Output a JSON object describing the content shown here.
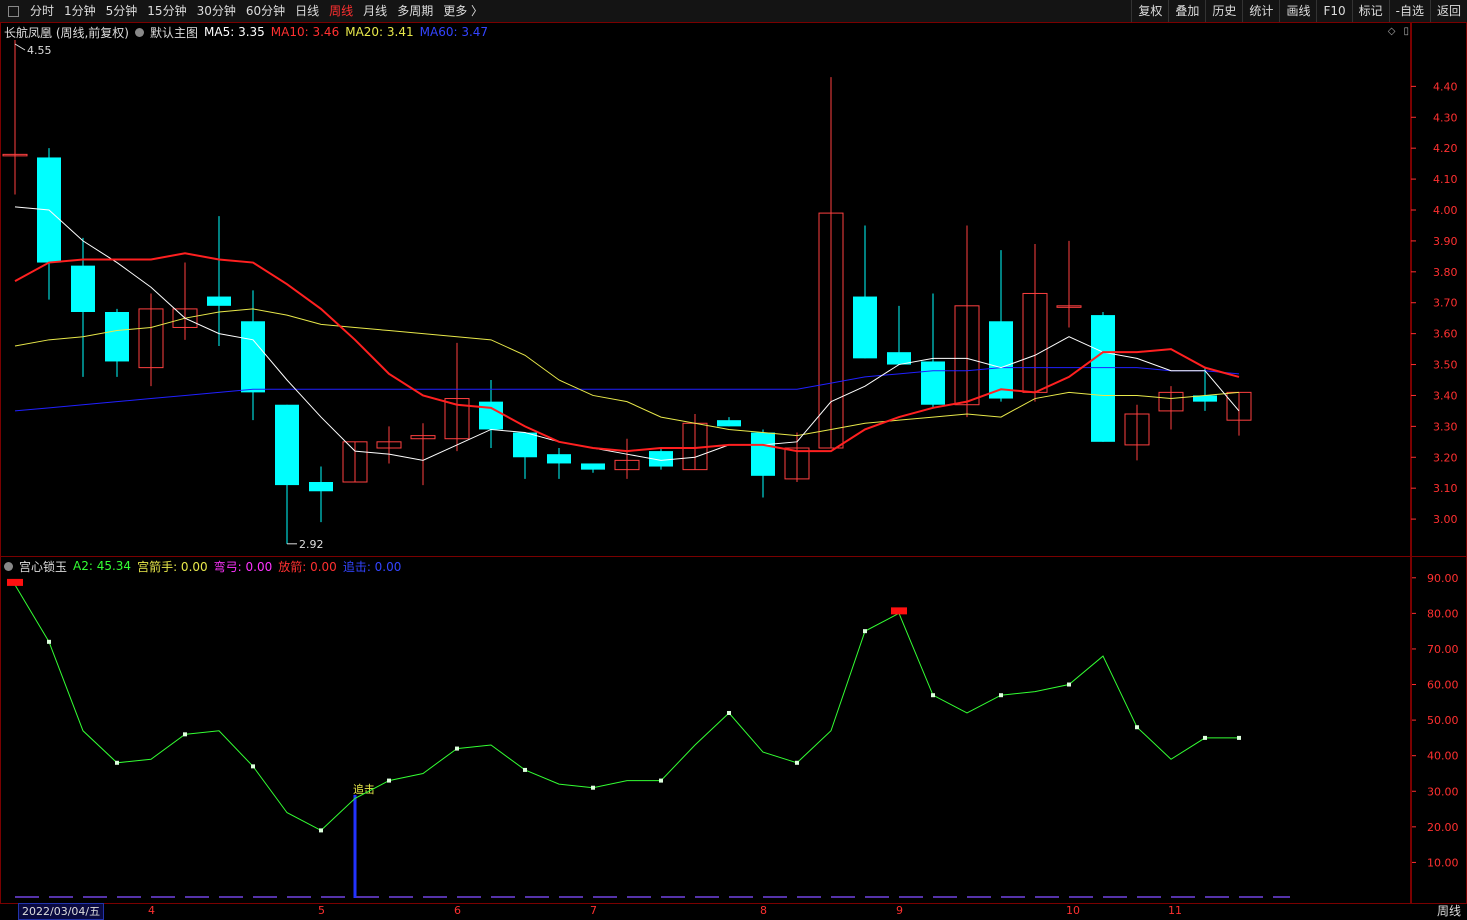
{
  "toolbar": {
    "periods": [
      "分时",
      "1分钟",
      "5分钟",
      "15分钟",
      "30分钟",
      "60分钟",
      "日线",
      "周线",
      "月线",
      "多周期",
      "更多 〉"
    ],
    "active_index": 7,
    "right_buttons": [
      "复权",
      "叠加",
      "历史",
      "统计",
      "画线",
      "F10",
      "标记",
      "-自选",
      "返回"
    ]
  },
  "main_header": {
    "stock": "长航凤凰 (周线,前复权)",
    "template": "默认主图",
    "ma5": "MA5: 3.35",
    "ma10": "MA10: 3.46",
    "ma20": "MA20: 3.41",
    "ma60": "MA60: 3.47"
  },
  "sub_header": {
    "name": "宫心锁玉",
    "a2": "A2: 45.34",
    "archer": "宫箭手: 0.00",
    "bow": "弯弓: 0.00",
    "fire": "放箭: 0.00",
    "chase": "追击: 0.00"
  },
  "colors": {
    "up": "#ff4040",
    "down": "#00ffff",
    "ma5": "#ffffff",
    "ma10": "#ff2020",
    "ma20": "#e8e84a",
    "ma60": "#2020ff",
    "a2": "#33ff33",
    "axis": "#ff3030"
  },
  "chart_data": [
    {
      "type": "candlestick",
      "y_ticks": [
        3.0,
        3.1,
        3.2,
        3.3,
        3.4,
        3.5,
        3.6,
        3.7,
        3.8,
        3.9,
        4.0,
        4.1,
        4.2,
        4.3,
        4.4
      ],
      "ylim": [
        2.9,
        4.55
      ],
      "high_label": "4.55",
      "low_label": "2.92",
      "candles": [
        {
          "o": 4.18,
          "c": 4.18,
          "h": 4.55,
          "l": 4.05
        },
        {
          "o": 4.17,
          "c": 3.83,
          "h": 4.2,
          "l": 3.71
        },
        {
          "o": 3.82,
          "c": 3.67,
          "h": 3.91,
          "l": 3.46
        },
        {
          "o": 3.67,
          "c": 3.51,
          "h": 3.68,
          "l": 3.46
        },
        {
          "o": 3.49,
          "c": 3.68,
          "h": 3.73,
          "l": 3.43
        },
        {
          "o": 3.62,
          "c": 3.68,
          "h": 3.83,
          "l": 3.58
        },
        {
          "o": 3.72,
          "c": 3.69,
          "h": 3.98,
          "l": 3.56
        },
        {
          "o": 3.64,
          "c": 3.41,
          "h": 3.74,
          "l": 3.32
        },
        {
          "o": 3.37,
          "c": 3.11,
          "h": 3.37,
          "l": 2.92
        },
        {
          "o": 3.12,
          "c": 3.09,
          "h": 3.17,
          "l": 2.99
        },
        {
          "o": 3.12,
          "c": 3.25,
          "h": 3.25,
          "l": 3.12
        },
        {
          "o": 3.23,
          "c": 3.25,
          "h": 3.3,
          "l": 3.18
        },
        {
          "o": 3.26,
          "c": 3.27,
          "h": 3.31,
          "l": 3.11
        },
        {
          "o": 3.26,
          "c": 3.39,
          "h": 3.57,
          "l": 3.22
        },
        {
          "o": 3.38,
          "c": 3.29,
          "h": 3.45,
          "l": 3.23
        },
        {
          "o": 3.28,
          "c": 3.2,
          "h": 3.28,
          "l": 3.13
        },
        {
          "o": 3.21,
          "c": 3.18,
          "h": 3.23,
          "l": 3.13
        },
        {
          "o": 3.18,
          "c": 3.16,
          "h": 3.18,
          "l": 3.15
        },
        {
          "o": 3.16,
          "c": 3.19,
          "h": 3.26,
          "l": 3.13
        },
        {
          "o": 3.22,
          "c": 3.17,
          "h": 3.23,
          "l": 3.16
        },
        {
          "o": 3.16,
          "c": 3.31,
          "h": 3.34,
          "l": 3.16
        },
        {
          "o": 3.32,
          "c": 3.3,
          "h": 3.33,
          "l": 3.3
        },
        {
          "o": 3.28,
          "c": 3.14,
          "h": 3.29,
          "l": 3.07
        },
        {
          "o": 3.13,
          "c": 3.23,
          "h": 3.28,
          "l": 3.12
        },
        {
          "o": 3.23,
          "c": 3.99,
          "h": 4.43,
          "l": 3.23
        },
        {
          "o": 3.72,
          "c": 3.52,
          "h": 3.95,
          "l": 3.52
        },
        {
          "o": 3.54,
          "c": 3.5,
          "h": 3.69,
          "l": 3.5
        },
        {
          "o": 3.51,
          "c": 3.37,
          "h": 3.73,
          "l": 3.36
        },
        {
          "o": 3.37,
          "c": 3.69,
          "h": 3.95,
          "l": 3.33
        },
        {
          "o": 3.64,
          "c": 3.39,
          "h": 3.87,
          "l": 3.38
        },
        {
          "o": 3.41,
          "c": 3.73,
          "h": 3.89,
          "l": 3.38
        },
        {
          "o": 3.69,
          "c": 3.69,
          "h": 3.9,
          "l": 3.62
        },
        {
          "o": 3.66,
          "c": 3.25,
          "h": 3.67,
          "l": 3.25
        },
        {
          "o": 3.24,
          "c": 3.34,
          "h": 3.37,
          "l": 3.19
        },
        {
          "o": 3.35,
          "c": 3.41,
          "h": 3.43,
          "l": 3.29
        },
        {
          "o": 3.4,
          "c": 3.38,
          "h": 3.49,
          "l": 3.35
        },
        {
          "o": 3.32,
          "c": 3.41,
          "h": 3.41,
          "l": 3.27
        }
      ],
      "ma5": [
        4.01,
        4.0,
        3.9,
        3.83,
        3.75,
        3.65,
        3.6,
        3.58,
        3.45,
        3.33,
        3.22,
        3.21,
        3.19,
        3.24,
        3.29,
        3.28,
        3.25,
        3.23,
        3.21,
        3.19,
        3.2,
        3.24,
        3.24,
        3.25,
        3.38,
        3.43,
        3.5,
        3.52,
        3.52,
        3.49,
        3.53,
        3.59,
        3.54,
        3.52,
        3.48,
        3.48,
        3.35
      ],
      "ma10": [
        3.77,
        3.83,
        3.84,
        3.84,
        3.84,
        3.86,
        3.84,
        3.83,
        3.76,
        3.68,
        3.58,
        3.47,
        3.4,
        3.37,
        3.36,
        3.3,
        3.25,
        3.23,
        3.22,
        3.23,
        3.23,
        3.24,
        3.24,
        3.22,
        3.22,
        3.29,
        3.33,
        3.36,
        3.38,
        3.42,
        3.41,
        3.46,
        3.54,
        3.54,
        3.55,
        3.49,
        3.46
      ],
      "ma20": [
        3.56,
        3.58,
        3.59,
        3.61,
        3.62,
        3.65,
        3.67,
        3.68,
        3.66,
        3.63,
        3.62,
        3.61,
        3.6,
        3.59,
        3.58,
        3.53,
        3.45,
        3.4,
        3.38,
        3.33,
        3.31,
        3.29,
        3.28,
        3.27,
        3.29,
        3.31,
        3.32,
        3.33,
        3.34,
        3.33,
        3.39,
        3.41,
        3.4,
        3.4,
        3.39,
        3.4,
        3.41
      ],
      "ma60": [
        3.35,
        3.36,
        3.37,
        3.38,
        3.39,
        3.4,
        3.41,
        3.42,
        3.42,
        3.42,
        3.42,
        3.42,
        3.42,
        3.42,
        3.42,
        3.42,
        3.42,
        3.42,
        3.42,
        3.42,
        3.42,
        3.42,
        3.42,
        3.42,
        3.44,
        3.46,
        3.47,
        3.48,
        3.48,
        3.49,
        3.49,
        3.49,
        3.49,
        3.49,
        3.48,
        3.48,
        3.47
      ]
    },
    {
      "type": "line",
      "y_ticks": [
        10,
        20,
        30,
        40,
        50,
        60,
        70,
        80,
        90
      ],
      "ylim": [
        0,
        95
      ],
      "a2": [
        88,
        72,
        47,
        38,
        39,
        46,
        47,
        37,
        24,
        19,
        28,
        33,
        35,
        42,
        43,
        36,
        32,
        31,
        33,
        33,
        43,
        52,
        41,
        38,
        47,
        75,
        80,
        57,
        52,
        57,
        58,
        60,
        68,
        48,
        39,
        45,
        45
      ],
      "buy_markers": [
        0,
        26
      ],
      "chase_index": 10,
      "chase_value": 29,
      "chase_label": "追击"
    }
  ],
  "x_axis": {
    "date_label": "2022/03/04/五",
    "months": [
      {
        "label": "4",
        "i": 4
      },
      {
        "label": "5",
        "i": 9
      },
      {
        "label": "6",
        "i": 13
      },
      {
        "label": "7",
        "i": 17
      },
      {
        "label": "8",
        "i": 22
      },
      {
        "label": "9",
        "i": 26
      },
      {
        "label": "10",
        "i": 31
      },
      {
        "label": "11",
        "i": 34
      }
    ],
    "corner": "周线"
  }
}
